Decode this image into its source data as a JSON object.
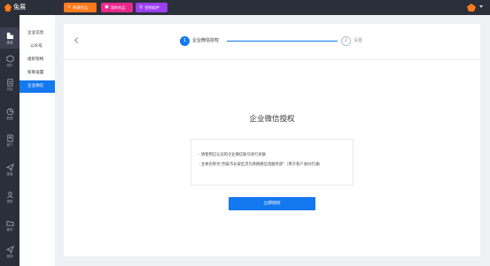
{
  "app": {
    "logo_text": "兔展"
  },
  "topbar": {
    "buttons": [
      {
        "icon": "plus-icon",
        "label": "新建作品",
        "color": "#ff7a1a"
      },
      {
        "icon": "folder-icon",
        "label": "我的作品",
        "color": "#e8288c"
      },
      {
        "icon": "gear-icon",
        "label": "营销组件",
        "color": "#9b3ff2"
      }
    ]
  },
  "rail": {
    "items": [
      {
        "icon": "enterprise-icon",
        "label": "企业",
        "active": true
      },
      {
        "icon": "component-icon",
        "label": "组件"
      },
      {
        "icon": "content-icon",
        "label": "内容"
      },
      {
        "icon": "data-icon",
        "label": "数据"
      },
      {
        "icon": "customer-icon",
        "label": "客户"
      },
      {
        "icon": "channel-icon",
        "label": "渠道"
      },
      {
        "icon": "sales-icon",
        "label": "销售"
      },
      {
        "icon": "material-icon",
        "label": "素材"
      },
      {
        "icon": "marketing-icon",
        "label": "营销"
      }
    ]
  },
  "subnav": {
    "items": [
      {
        "label": "企业信息"
      },
      {
        "label": "公众号"
      },
      {
        "label": "组织架构"
      },
      {
        "label": "权限设置"
      },
      {
        "label": "企业微信",
        "active": true
      }
    ]
  },
  "steps": [
    {
      "number": "1",
      "label": "企业微信授权",
      "active": true
    },
    {
      "number": "2",
      "label": "设置"
    }
  ],
  "main": {
    "title": "企业微信授权",
    "notes": [
      "- 请使用已认证的企业微信账号进行关联",
      "- 主体名称为\"西安市长安区济凡青网络信息服务部\"（用于客户身份打通）"
    ],
    "cta_label": "立即授权"
  },
  "colors": {
    "accent": "#1478f0",
    "sidebar_dark": "#2b2f3a"
  }
}
